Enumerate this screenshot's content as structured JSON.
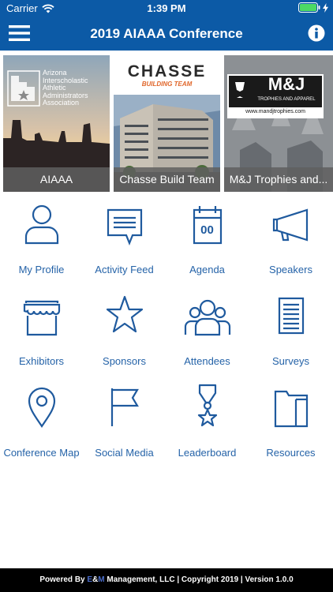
{
  "status_bar": {
    "carrier": "Carrier",
    "time": "1:39 PM"
  },
  "header": {
    "title": "2019 AIAAA Conference"
  },
  "banners": [
    {
      "label": "AIAAA",
      "logo_text": "Arizona Interscholastic Athletic Administrators Association",
      "logo_mark": "AIAAA"
    },
    {
      "label": "Chasse Build Team",
      "logo_main": "CHASSE",
      "logo_sub": "BUILDING TEAM"
    },
    {
      "label": "M&J Trophies and...",
      "logo_main": "M&J",
      "logo_sub": "TROPHIES AND APPAREL",
      "logo_url": "www.mandjtrophies.com"
    }
  ],
  "menu": [
    {
      "label": "My Profile",
      "icon": "person-icon"
    },
    {
      "label": "Activity Feed",
      "icon": "chat-bubble-icon"
    },
    {
      "label": "Agenda",
      "icon": "calendar-icon",
      "icon_text": "00"
    },
    {
      "label": "Speakers",
      "icon": "megaphone-icon"
    },
    {
      "label": "Exhibitors",
      "icon": "storefront-icon"
    },
    {
      "label": "Sponsors",
      "icon": "star-icon"
    },
    {
      "label": "Attendees",
      "icon": "group-icon"
    },
    {
      "label": "Surveys",
      "icon": "document-icon"
    },
    {
      "label": "Conference Map",
      "icon": "map-pin-icon"
    },
    {
      "label": "Social Media",
      "icon": "flag-icon"
    },
    {
      "label": "Leaderboard",
      "icon": "medal-icon"
    },
    {
      "label": "Resources",
      "icon": "folder-icon"
    }
  ],
  "footer": {
    "powered_by": "Powered By ",
    "em_e": "E",
    "em_amp": "&",
    "em_m": "M",
    "rest": " Management, LLC | Copyright 2019 | Version 1.0.0"
  },
  "colors": {
    "header_bg": "#0c5aa6",
    "icon_stroke": "#1f5a9e",
    "label_text": "#2563a8",
    "footer_bg": "#000000"
  }
}
